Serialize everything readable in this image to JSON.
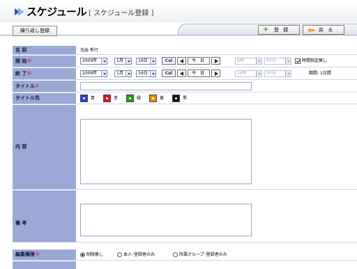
{
  "header": {
    "title": "スケジュール",
    "subtitle": "[ スケジュール登録 ]"
  },
  "toolbar": {
    "repeat_label": "繰り返し登録",
    "register_label": "登 録",
    "back_label": "戻 る"
  },
  "form": {
    "name": {
      "label": "名 前",
      "value": "北出 秀行"
    },
    "start": {
      "label": "開 始",
      "required": "※",
      "year": "2009年",
      "month": "1月",
      "day": "16日",
      "cal": "Cal",
      "today": "今 日",
      "hour": "9時",
      "minute": "00分",
      "no_time_label": "時間指定無し"
    },
    "end": {
      "label": "終 了",
      "required": "※",
      "year": "2009年",
      "month": "1月",
      "day": "16日",
      "cal": "Cal",
      "today": "今 日",
      "hour": "18時",
      "minute": "00分",
      "period": "期間: 1日間"
    },
    "title": {
      "label": "タイトル",
      "required": "※",
      "value": ""
    },
    "title_color": {
      "label": "タイトル色",
      "options": [
        {
          "name": "青",
          "color": "#1d3fd0"
        },
        {
          "name": "赤",
          "color": "#e01616"
        },
        {
          "name": "緑",
          "color": "#17a017"
        },
        {
          "name": "黄",
          "color": "#f08a00"
        },
        {
          "name": "黒",
          "color": "#111111"
        }
      ]
    },
    "content": {
      "label": "内 容"
    },
    "remarks": {
      "label": "備 考"
    },
    "edit_permission": {
      "label": "編集権限",
      "required": "※",
      "options": [
        "制限無し",
        "本人･登録者のみ",
        "所属グループ･登録者のみ"
      ],
      "selected": 0
    }
  }
}
